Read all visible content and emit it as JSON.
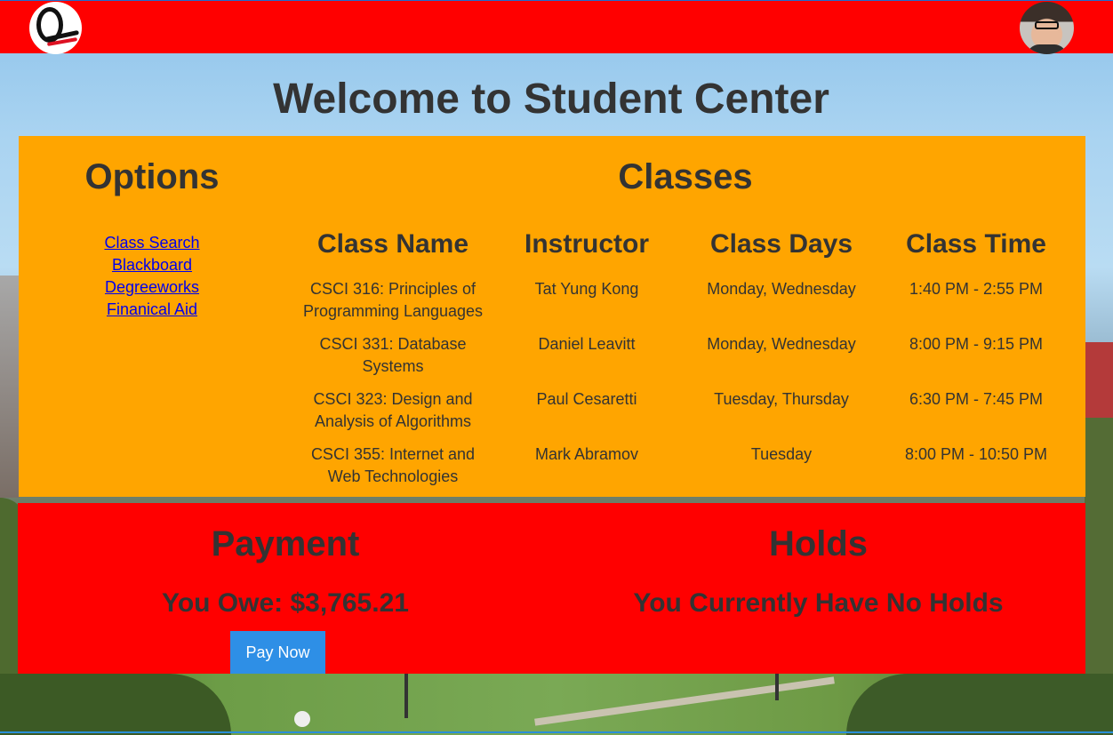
{
  "page": {
    "title": "Welcome to Student Center"
  },
  "options": {
    "title": "Options",
    "links": [
      {
        "label": "Class Search"
      },
      {
        "label": "Blackboard"
      },
      {
        "label": "Degreeworks"
      },
      {
        "label": "Finanical Aid"
      }
    ]
  },
  "classes": {
    "title": "Classes",
    "headers": {
      "name": "Class Name",
      "instructor": "Instructor",
      "days": "Class Days",
      "time": "Class Time"
    },
    "rows": [
      {
        "name": "CSCI 316: Principles of Programming Languages",
        "instructor": "Tat Yung Kong",
        "days": "Monday, Wednesday",
        "time": "1:40 PM - 2:55 PM"
      },
      {
        "name": "CSCI 331: Database Systems",
        "instructor": "Daniel Leavitt",
        "days": "Monday, Wednesday",
        "time": "8:00 PM - 9:15 PM"
      },
      {
        "name": "CSCI 323: Design and Analysis of Algorithms",
        "instructor": "Paul Cesaretti",
        "days": "Tuesday, Thursday",
        "time": "6:30 PM - 7:45 PM"
      },
      {
        "name": "CSCI 355: Internet and Web Technologies",
        "instructor": "Mark Abramov",
        "days": "Tuesday",
        "time": "8:00 PM - 10:50 PM"
      }
    ]
  },
  "payment": {
    "title": "Payment",
    "owe_text": "You Owe: $3,765.21",
    "pay_button": "Pay Now"
  },
  "holds": {
    "title": "Holds",
    "status_text": "You Currently Have No Holds"
  },
  "colors": {
    "header": "#ff0000",
    "classes_panel": "#ffa500",
    "bottom_panel": "#ff0000",
    "pay_button": "#2e8fe6",
    "link": "#0000ee"
  }
}
